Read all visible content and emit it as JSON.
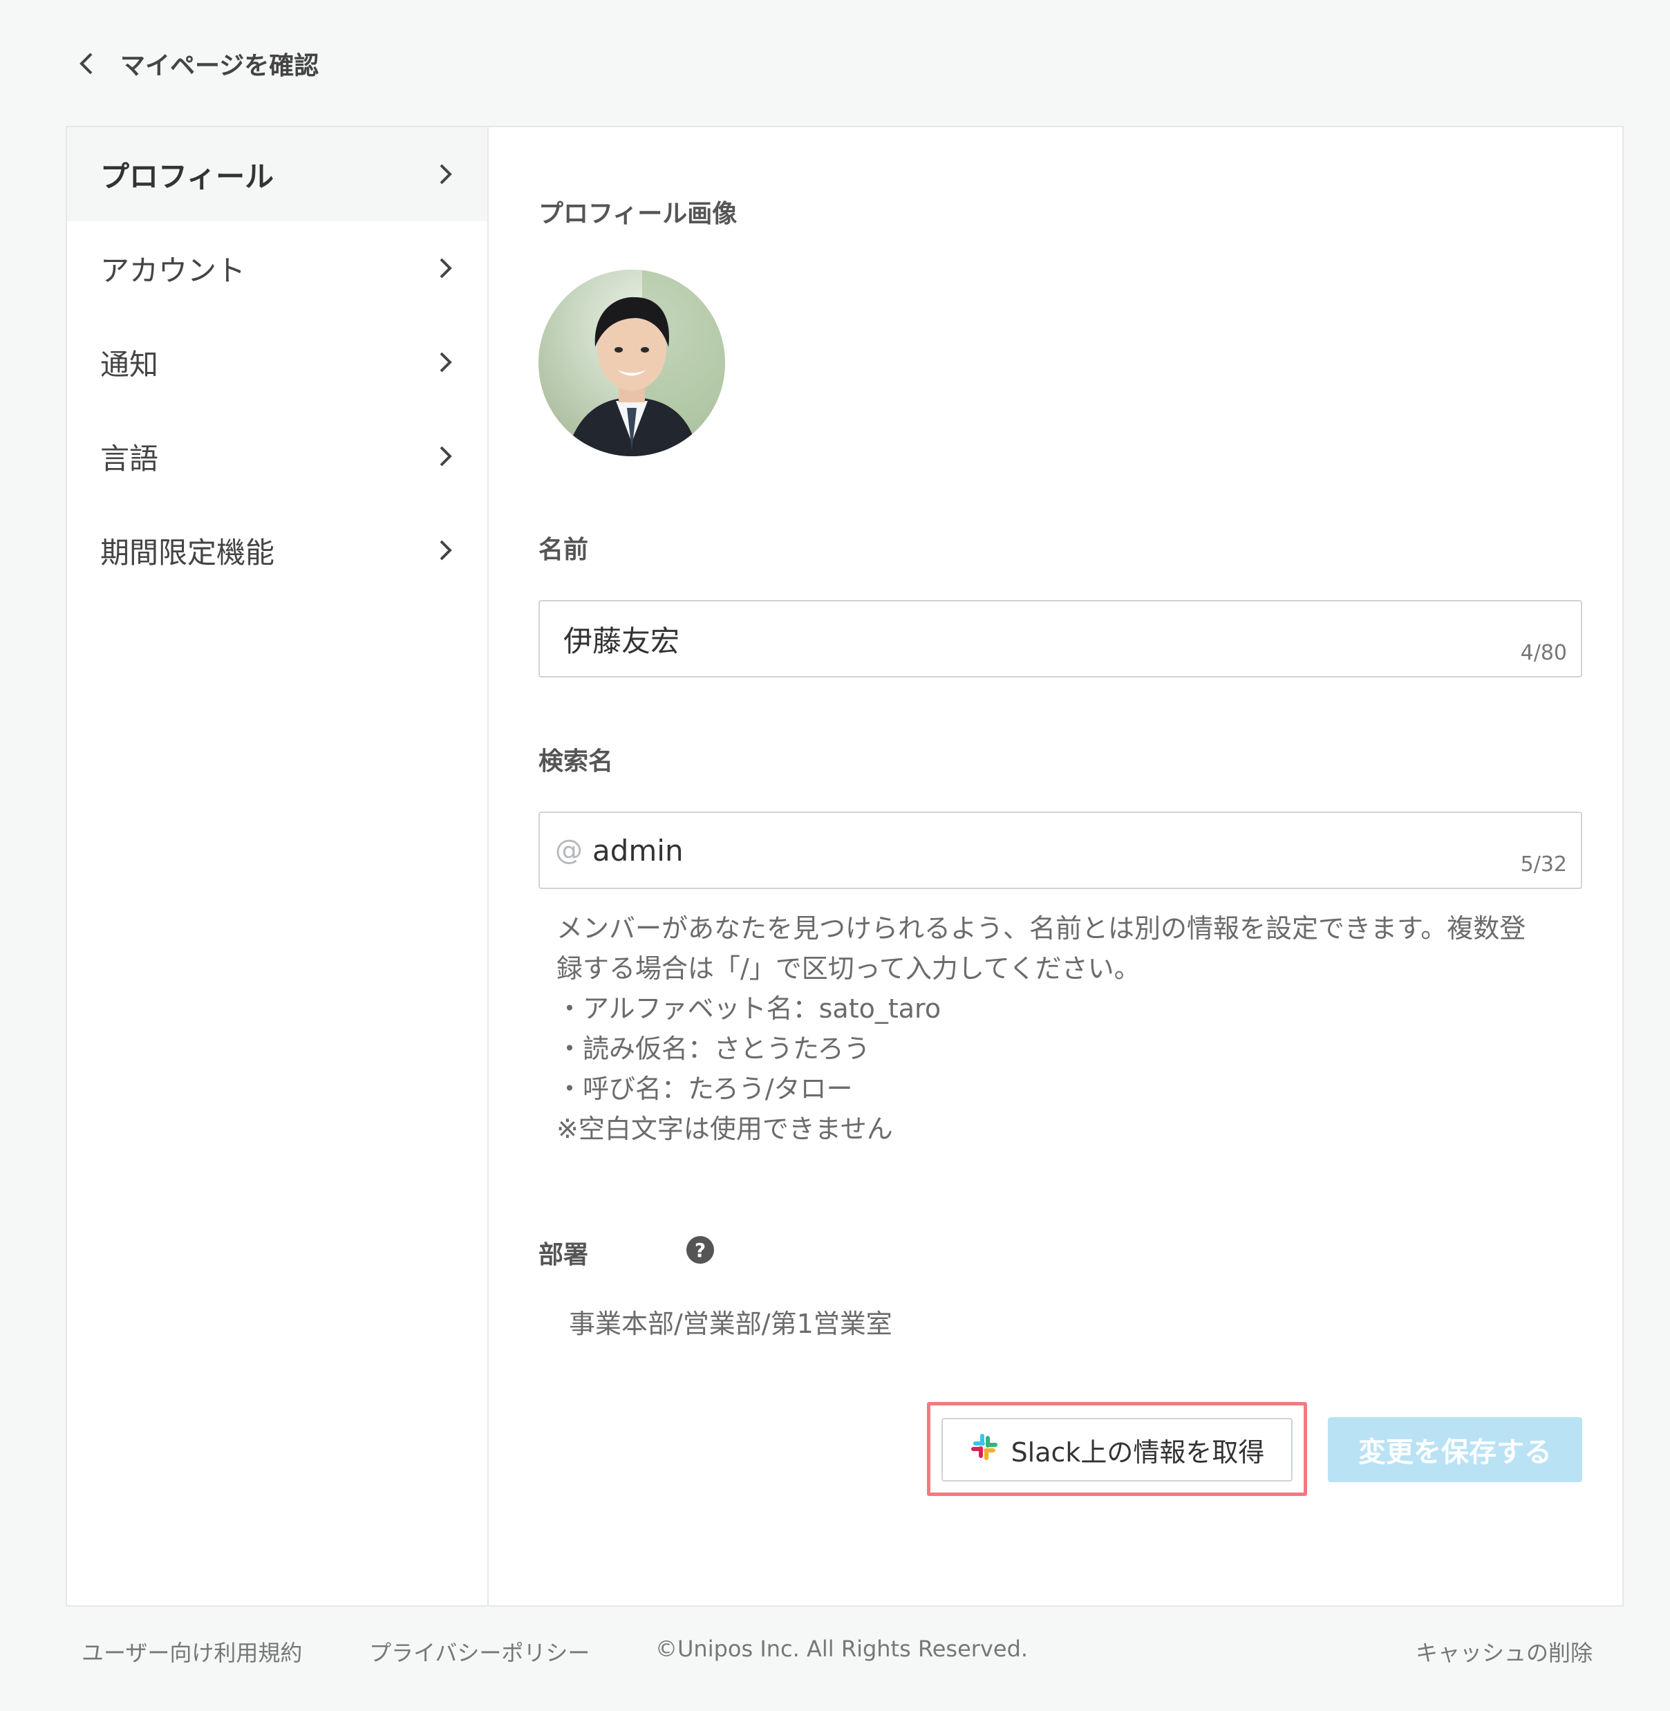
{
  "header": {
    "back_label": "マイページを確認"
  },
  "sidebar": {
    "items": [
      {
        "label": "プロフィール",
        "active": true
      },
      {
        "label": "アカウント"
      },
      {
        "label": "通知"
      },
      {
        "label": "言語"
      },
      {
        "label": "期間限定機能"
      }
    ]
  },
  "profile": {
    "image_label": "プロフィール画像",
    "name_label": "名前",
    "name_value": "伊藤友宏",
    "name_counter": "4/80",
    "search_label": "検索名",
    "search_prefix": "@",
    "search_value": "admin",
    "search_counter": "5/32",
    "help_lines": [
      "メンバーがあなたを見つけられるよう、名前とは別の情報を設定できます。複数登",
      "録する場合は「/」で区切って入力してください。",
      "・アルファベット名：sato_taro",
      "・読み仮名：さとうたろう",
      "・呼び名：たろう/タロー",
      "※空白文字は使用できません"
    ],
    "dept_label": "部署",
    "dept_value": "事業本部/営業部/第1営業室"
  },
  "actions": {
    "slack_label": "Slack上の情報を取得",
    "save_label": "変更を保存する"
  },
  "footer": {
    "terms": "ユーザー向け利用規約",
    "privacy": "プライバシーポリシー",
    "copyright": "©Unipos Inc. All Rights Reserved.",
    "clear_cache": "キャッシュの削除"
  },
  "colors": {
    "highlight": "#ef7b7f",
    "save_button": "#b9e2f4",
    "slack": [
      "#36c5f0",
      "#2eb67d",
      "#ecb22e",
      "#e01e5a"
    ]
  },
  "icons": [
    "chevron-left-icon",
    "chevron-right-icon",
    "help-icon",
    "slack-icon"
  ]
}
